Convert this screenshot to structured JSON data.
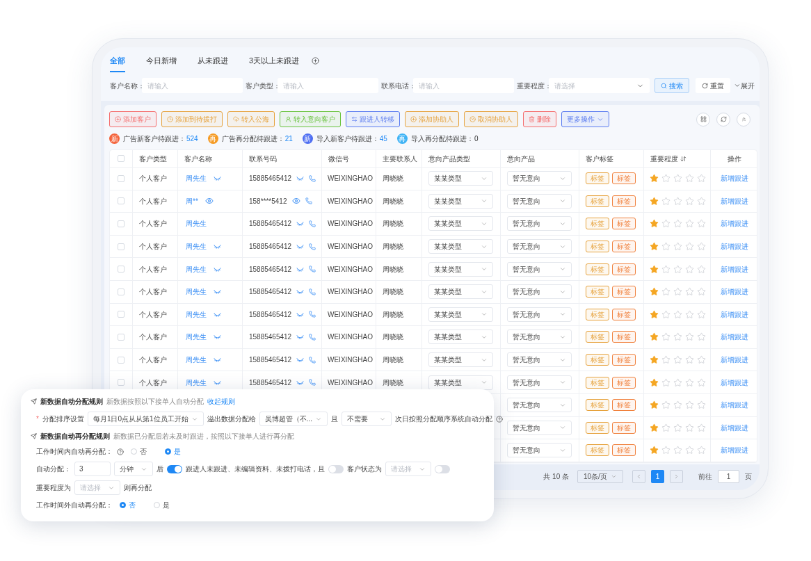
{
  "tabs": [
    {
      "label": "全部",
      "selected": true
    },
    {
      "label": "今日新增",
      "selected": false
    },
    {
      "label": "从未跟进",
      "selected": false
    },
    {
      "label": "3天以上未跟进",
      "selected": false
    }
  ],
  "filters": [
    {
      "label": "客户名称：",
      "placeholder": "请输入",
      "kind": "input"
    },
    {
      "label": "客户类型：",
      "placeholder": "请输入",
      "kind": "input"
    },
    {
      "label": "联系电话：",
      "placeholder": "请输入",
      "kind": "input"
    },
    {
      "label": "重要程度：",
      "placeholder": "请选择",
      "kind": "select"
    }
  ],
  "filter_buttons": {
    "search": "搜索",
    "reset": "重置",
    "expand": "展开"
  },
  "actions": [
    {
      "label": "添加客户",
      "color": "#f56c6c",
      "kind": "button"
    },
    {
      "label": "添加到待拨打",
      "color": "#e6a23c",
      "kind": "button"
    },
    {
      "label": "转入公海",
      "color": "#e6a23c",
      "kind": "button"
    },
    {
      "label": "转入意向客户",
      "color": "#67c23a",
      "kind": "button"
    },
    {
      "label": "跟进人转移",
      "color": "#5b7cf0",
      "kind": "button"
    },
    {
      "label": "添加协助人",
      "color": "#e6a23c",
      "kind": "button"
    },
    {
      "label": "取消协助人",
      "color": "#e6a23c",
      "kind": "button"
    },
    {
      "label": "删除",
      "color": "#f56c6c",
      "kind": "button"
    },
    {
      "label": "更多操作",
      "color": "#5b7cf0",
      "kind": "dropdown"
    }
  ],
  "stats": [
    {
      "badge": "新",
      "label": "广告新客户待跟进：",
      "count": "524",
      "color": "#f4643c",
      "highlight": true
    },
    {
      "badge": "再",
      "label": "广告再分配待跟进：",
      "count": "21",
      "color": "#f59a23",
      "highlight": true
    },
    {
      "badge": "新",
      "label": "导入新客户待跟进：",
      "count": "45",
      "color": "#4e6ef2",
      "highlight": true
    },
    {
      "badge": "再",
      "label": "导入再分配待跟进：",
      "count": "0",
      "color": "#3fb3f5",
      "highlight": false
    }
  ],
  "table": {
    "header_checked": false,
    "columns": [
      {
        "label": "客户类型",
        "sortable": false
      },
      {
        "label": "客户名称",
        "sortable": false
      },
      {
        "label": "联系号码",
        "sortable": false
      },
      {
        "label": "微信号",
        "sortable": false
      },
      {
        "label": "主要联系人",
        "sortable": false
      },
      {
        "label": "意向产品类型",
        "sortable": false
      },
      {
        "label": "意向产品",
        "sortable": false
      },
      {
        "label": "客户标签",
        "sortable": false
      },
      {
        "label": "重要程度",
        "sortable": true
      },
      {
        "label": "操作",
        "sortable": false
      }
    ],
    "rows": [
      {
        "checked": false,
        "type": "个人客户",
        "name": "周先生",
        "name_toggle": true,
        "name_masked": false,
        "phone": "15885465412",
        "phone_masked": false,
        "wechat": "WEIXINGHAO",
        "contact": "周晓晓",
        "product_type": "某某类型",
        "product": "暂无意向",
        "tags": [
          {
            "label": "标签",
            "color": "#e6a23c"
          },
          {
            "label": "标签",
            "color": "#f0803c"
          }
        ],
        "stars": 1,
        "action": "新增跟进"
      },
      {
        "checked": false,
        "type": "个人客户",
        "name": "周**",
        "name_toggle": true,
        "name_masked": true,
        "phone": "158****5412",
        "phone_masked": true,
        "wechat": "WEIXINGHAO",
        "contact": "周晓晓",
        "product_type": "某某类型",
        "product": "暂无意向",
        "tags": [
          {
            "label": "标签",
            "color": "#e6a23c"
          },
          {
            "label": "标签",
            "color": "#f0803c"
          }
        ],
        "stars": 1,
        "action": "新增跟进"
      },
      {
        "checked": false,
        "type": "个人客户",
        "name": "周先生",
        "name_toggle": false,
        "phone": "15885465412",
        "phone_masked": false,
        "wechat": "WEIXINGHAO",
        "contact": "周晓晓",
        "product_type": "某某类型",
        "product": "暂无意向",
        "tags": [
          {
            "label": "标签",
            "color": "#e6a23c"
          },
          {
            "label": "标签",
            "color": "#f0803c"
          }
        ],
        "stars": 1,
        "action": "新增跟进"
      },
      {
        "checked": false,
        "type": "个人客户",
        "name": "周先生",
        "name_toggle": true,
        "name_masked": false,
        "phone": "15885465412",
        "phone_masked": false,
        "wechat": "WEIXINGHAO",
        "contact": "周晓晓",
        "product_type": "某某类型",
        "product": "暂无意向",
        "tags": [
          {
            "label": "标签",
            "color": "#e6a23c"
          },
          {
            "label": "标签",
            "color": "#f0803c"
          }
        ],
        "stars": 1,
        "action": "新增跟进"
      },
      {
        "checked": false,
        "type": "个人客户",
        "name": "周先生",
        "name_toggle": true,
        "name_masked": false,
        "phone": "15885465412",
        "phone_masked": false,
        "wechat": "WEIXINGHAO",
        "contact": "周晓晓",
        "product_type": "某某类型",
        "product": "暂无意向",
        "tags": [
          {
            "label": "标签",
            "color": "#e6a23c"
          },
          {
            "label": "标签",
            "color": "#f0803c"
          }
        ],
        "stars": 1,
        "action": "新增跟进"
      },
      {
        "checked": false,
        "type": "个人客户",
        "name": "周先生",
        "name_toggle": true,
        "name_masked": false,
        "phone": "15885465412",
        "phone_masked": false,
        "wechat": "WEIXINGHAO",
        "contact": "周晓晓",
        "product_type": "某某类型",
        "product": "暂无意向",
        "tags": [
          {
            "label": "标签",
            "color": "#e6a23c"
          },
          {
            "label": "标签",
            "color": "#f0803c"
          }
        ],
        "stars": 1,
        "action": "新增跟进"
      },
      {
        "checked": false,
        "type": "个人客户",
        "name": "周先生",
        "name_toggle": true,
        "name_masked": false,
        "phone": "15885465412",
        "phone_masked": false,
        "wechat": "WEIXINGHAO",
        "contact": "周晓晓",
        "product_type": "某某类型",
        "product": "暂无意向",
        "tags": [
          {
            "label": "标签",
            "color": "#e6a23c"
          },
          {
            "label": "标签",
            "color": "#f0803c"
          }
        ],
        "stars": 1,
        "action": "新增跟进"
      },
      {
        "checked": false,
        "type": "个人客户",
        "name": "周先生",
        "name_toggle": true,
        "name_masked": false,
        "phone": "15885465412",
        "phone_masked": false,
        "wechat": "WEIXINGHAO",
        "contact": "周晓晓",
        "product_type": "某某类型",
        "product": "暂无意向",
        "tags": [
          {
            "label": "标签",
            "color": "#e6a23c"
          },
          {
            "label": "标签",
            "color": "#f0803c"
          }
        ],
        "stars": 1,
        "action": "新增跟进"
      },
      {
        "checked": false,
        "type": "个人客户",
        "name": "周先生",
        "name_toggle": true,
        "name_masked": false,
        "phone": "15885465412",
        "phone_masked": false,
        "wechat": "WEIXINGHAO",
        "contact": "周晓晓",
        "product_type": "某某类型",
        "product": "暂无意向",
        "tags": [
          {
            "label": "标签",
            "color": "#e6a23c"
          },
          {
            "label": "标签",
            "color": "#f0803c"
          }
        ],
        "stars": 1,
        "action": "新增跟进"
      },
      {
        "checked": false,
        "type": "个人客户",
        "name": "周先生",
        "name_toggle": true,
        "name_masked": false,
        "phone": "15885465412",
        "phone_masked": false,
        "wechat": "WEIXINGHAO",
        "contact": "周晓晓",
        "product_type": "某某类型",
        "product": "暂无意向",
        "tags": [
          {
            "label": "标签",
            "color": "#e6a23c"
          },
          {
            "label": "标签",
            "color": "#f0803c"
          }
        ],
        "stars": 1,
        "action": "新增跟进"
      },
      {
        "product": "暂无意向",
        "tags": [
          {
            "label": "标签",
            "color": "#e6a23c"
          },
          {
            "label": "标签",
            "color": "#f0803c"
          }
        ],
        "stars": 1,
        "action": "新增跟进"
      },
      {
        "product": "暂无意向",
        "tags": [
          {
            "label": "标签",
            "color": "#e6a23c"
          },
          {
            "label": "标签",
            "color": "#f0803c"
          }
        ],
        "stars": 1,
        "action": "新增跟进"
      },
      {
        "product": "暂无意向",
        "tags": [
          {
            "label": "标签",
            "color": "#e6a23c"
          },
          {
            "label": "标签",
            "color": "#f0803c"
          }
        ],
        "stars": 1,
        "action": "新增跟进"
      }
    ]
  },
  "pagination": {
    "total": "共 10 条",
    "page_size": "10条/页",
    "pages": [
      {
        "label": "1",
        "selected": true
      }
    ],
    "goto_label": "前往",
    "goto_value": "1",
    "goto_suffix": "页"
  },
  "rules_card": {
    "title1": "新数据自动分配规则",
    "hint1": "新数据按照以下接单人自动分配",
    "link1": "收起规则",
    "required_mark": "*",
    "sort_label": "分配排序设置",
    "sort_value": "每月1日0点从从第1位员工开始",
    "overflow_label": "溢出数据分配给",
    "overflow_value": "吴博超管（不...",
    "and_label": "且",
    "need_value": "不需要",
    "next_day_text": "次日按照分配顺序系统自动分配",
    "title2": "新数据自动再分配规则",
    "hint2": "新数据已分配后若未及时跟进，按照以下接单人进行再分配",
    "in_hours": {
      "label": "工作时间内自动再分配：",
      "options": [
        {
          "label": "否",
          "selected": false
        },
        {
          "label": "是",
          "selected": true
        }
      ]
    },
    "auto": {
      "label": "自动分配：",
      "minutes": "3",
      "unit": "分钟",
      "after": "后",
      "toggle1_on": true,
      "cond_text": "跟进人未跟进、未编辑资料、未拨打电话，且",
      "toggle2_on": false,
      "status_label": "客户状态为",
      "status_placeholder": "请选择",
      "toggle3_on": false,
      "importance_label": "重要程度为",
      "importance_placeholder": "请选择",
      "suffix": "则再分配"
    },
    "out_hours": {
      "label": "工作时间外自动再分配：",
      "options": [
        {
          "label": "否",
          "selected": true
        },
        {
          "label": "是",
          "selected": false
        }
      ]
    }
  }
}
